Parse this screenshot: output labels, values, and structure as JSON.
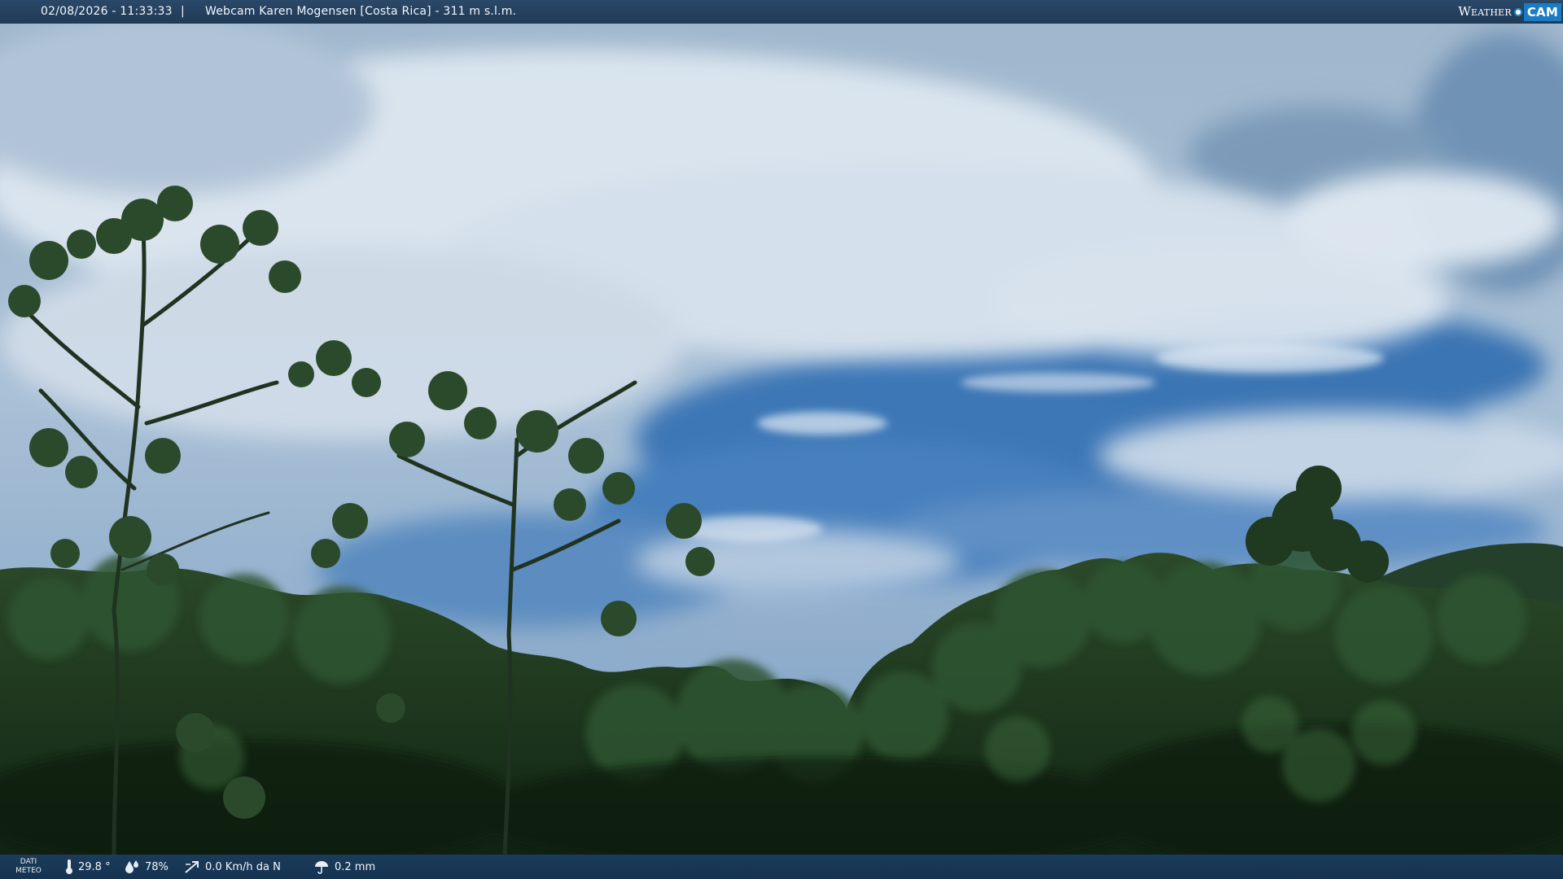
{
  "header": {
    "datetime": "02/08/2026 - 11:33:33",
    "separator": "|",
    "webcam_title": "Webcam Karen Mogensen [Costa Rica]  - 311 m s.l.m."
  },
  "logo": {
    "word": "Weather",
    "cam": "CAM"
  },
  "footer": {
    "dati_line1": "DATI",
    "dati_line2": "METEO",
    "temperature": "29.8 °",
    "humidity": "78%",
    "wind": "0.0 Km/h da N",
    "rain": "0.2 mm"
  },
  "icons": {
    "temperature": "thermometer-icon",
    "humidity": "humidity-drops-icon",
    "wind": "wind-icon",
    "rain": "rain-icon"
  },
  "colors": {
    "sky_blue": "#3f79b8",
    "cloud": "#d3dfea",
    "foliage_dark": "#142816",
    "bar": "#203a56",
    "brand": "#1b7cc3"
  }
}
